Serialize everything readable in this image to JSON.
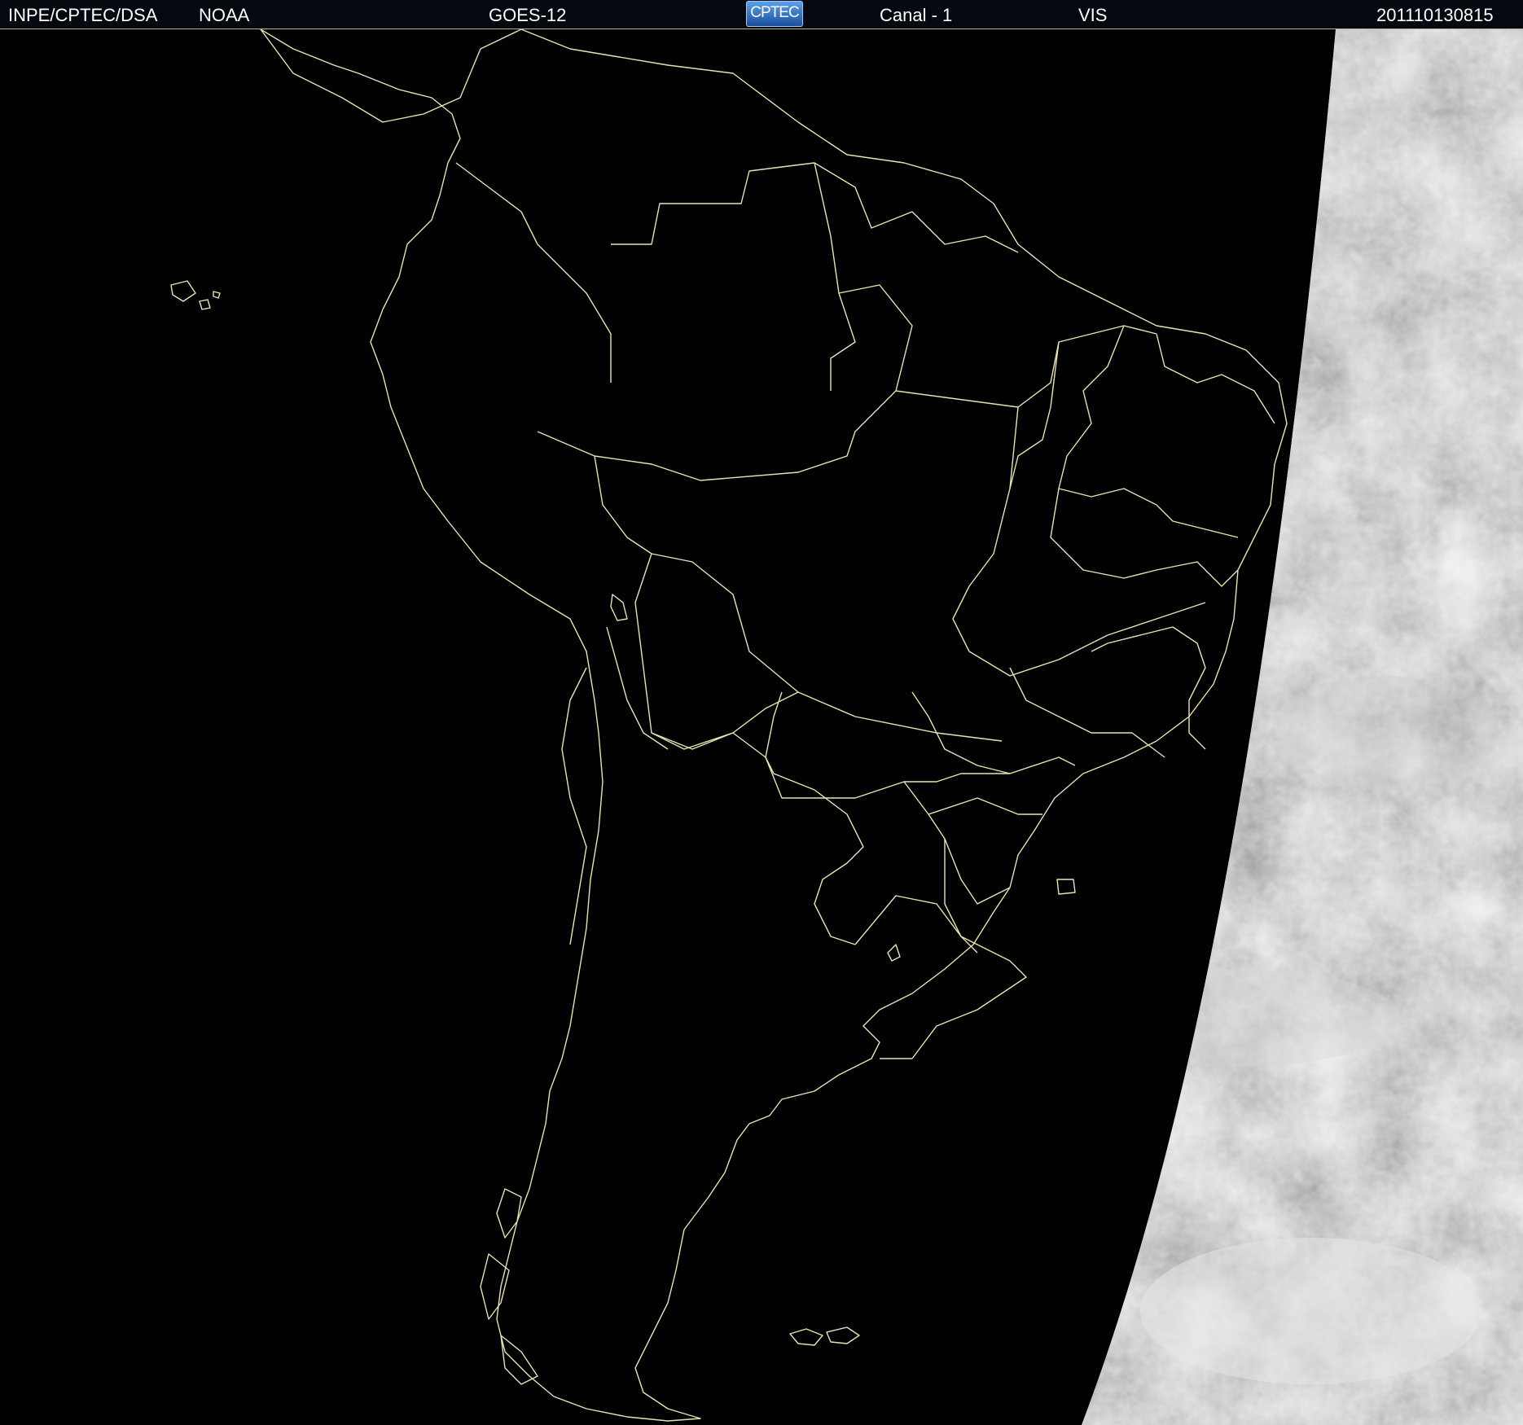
{
  "header": {
    "agency": "INPE/CPTEC/DSA",
    "source": "NOAA",
    "satellite": "GOES-12",
    "logo_text": "CPTEC",
    "channel": "Canal - 1",
    "band": "VIS",
    "timestamp": "201110130815"
  },
  "colors": {
    "background": "#000000",
    "coastline": "#e8e4b0",
    "header_bg": "#05090f",
    "header_text": "#ffffff"
  }
}
